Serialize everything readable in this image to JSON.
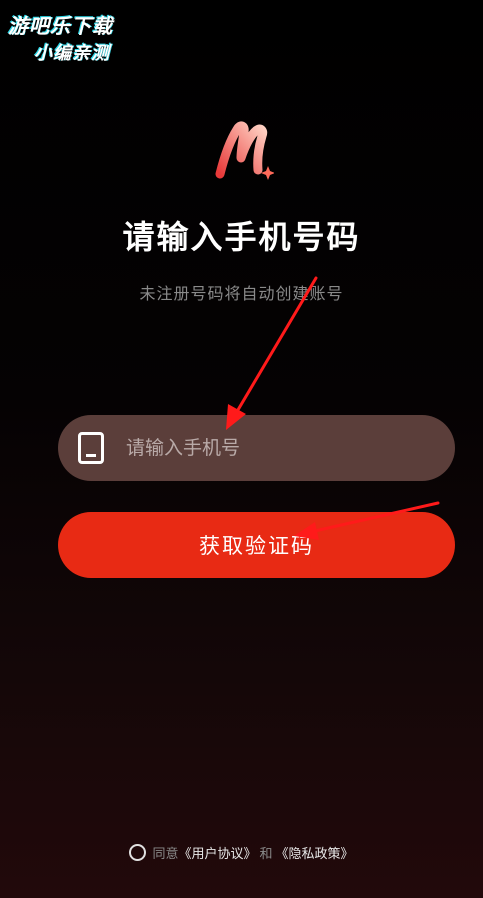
{
  "watermark": {
    "line1": "游吧乐下载",
    "line2": "小编亲测"
  },
  "login": {
    "title": "请输入手机号码",
    "subtitle": "未注册号码将自动创建账号",
    "phone_placeholder": "请输入手机号",
    "phone_value": "",
    "get_code_label": "获取验证码"
  },
  "agreement": {
    "prefix": "同意",
    "user_agreement": "《用户协议》",
    "and": "和",
    "privacy_policy": "《隐私政策》"
  },
  "icons": {
    "logo": "m-sparkle-logo-icon",
    "phone": "phone-icon",
    "radio": "radio-unchecked-icon",
    "annotation": "red-arrow-icon"
  },
  "colors": {
    "accent": "#e82a14",
    "input_bg": "#5b3e3a",
    "background": "#000000",
    "annotation": "#ff1a1a"
  }
}
